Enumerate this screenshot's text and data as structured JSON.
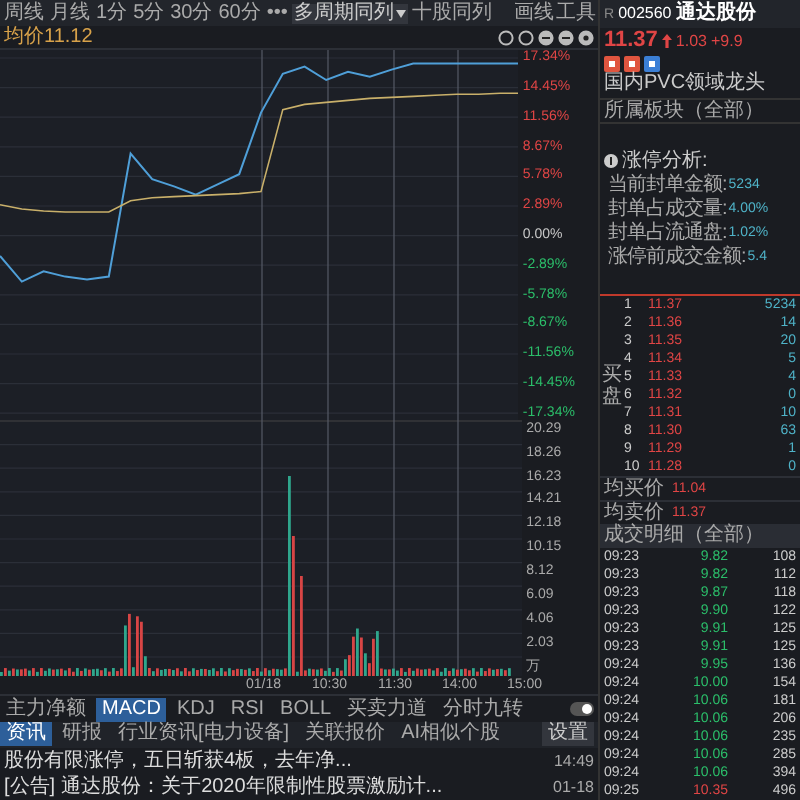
{
  "toolbar": {
    "tabs": [
      {
        "label": "周线",
        "selected": false
      },
      {
        "label": "月线",
        "selected": false
      },
      {
        "label": "1分",
        "selected": false
      },
      {
        "label": "5分",
        "selected": false
      },
      {
        "label": "30分",
        "selected": false
      },
      {
        "label": "60分",
        "selected": false
      },
      {
        "label": "•••",
        "selected": false
      }
    ],
    "multi_period": "多周期同列",
    "ten_stock": "十股同列",
    "tools": [
      "画线",
      "工具"
    ]
  },
  "chart": {
    "avg_price": "均价11.12",
    "chart_data": {
      "type": "line",
      "categories": [
        null,
        null,
        null,
        null,
        null,
        null,
        null,
        null,
        null,
        null,
        null,
        null,
        null,
        null,
        null,
        null,
        null,
        null,
        null,
        null,
        null,
        null,
        null,
        null,
        null
      ],
      "series": [
        {
          "color": "#4f9fd8",
          "values": [
            -2,
            -4.5,
            -3.5,
            -4,
            -4.3,
            -4,
            8,
            5.5,
            4.8,
            4,
            5,
            6,
            12,
            15.8,
            16.5,
            15.2,
            16,
            15.5,
            16.2,
            16.8,
            16.8,
            16.8,
            16.8,
            16.8,
            16.8
          ]
        },
        {
          "color": "#c9b06a",
          "values": [
            3,
            2.6,
            2.4,
            2.3,
            2.3,
            2.3,
            3.4,
            3.7,
            3.8,
            3.9,
            4,
            4.1,
            4.3,
            12.3,
            12.8,
            13,
            13.2,
            13.4,
            13.5,
            13.6,
            13.7,
            13.8,
            13.8,
            13.9,
            13.9
          ]
        }
      ],
      "ylim": [
        -17.34,
        17.34
      ],
      "grid": true,
      "yticks": [
        {
          "value": 17.34,
          "label": "17.34%"
        },
        {
          "value": 14.45,
          "label": "14.45%"
        },
        {
          "value": 11.56,
          "label": "11.56%"
        },
        {
          "value": 8.67,
          "label": "8.67%"
        },
        {
          "value": 5.78,
          "label": "5.78%"
        },
        {
          "value": 2.89,
          "label": "2.89%"
        },
        {
          "value": 0,
          "label": "0.00%"
        },
        {
          "value": -2.89,
          "label": "-2.89%"
        },
        {
          "value": -5.78,
          "label": "-5.78%"
        },
        {
          "value": -8.67,
          "label": "-8.67%"
        },
        {
          "value": -11.56,
          "label": "-11.56%"
        },
        {
          "value": -14.45,
          "label": "-14.45%"
        },
        {
          "value": -17.34,
          "label": "-17.34%"
        }
      ]
    },
    "time_labels": [
      "01/18",
      "10:30",
      "11:30",
      "14:00",
      "15:00"
    ],
    "volume_labels": [
      "20.29",
      "18.26",
      "16.23",
      "14.21",
      "12.18",
      "10.15",
      "8.12",
      "6.09",
      "4.06",
      "2.03",
      "万"
    ]
  },
  "indicator_tabs": [
    {
      "label": "主力净额",
      "selected": false
    },
    {
      "label": "MACD",
      "selected": true
    },
    {
      "label": "KDJ",
      "selected": false
    },
    {
      "label": "RSI",
      "selected": false
    },
    {
      "label": "BOLL",
      "selected": false
    },
    {
      "label": "买卖力道",
      "selected": false
    },
    {
      "label": "分时九转",
      "selected": false
    }
  ],
  "toggle": {
    "on": true
  },
  "news_tabs": [
    {
      "label": "资讯",
      "selected": true
    },
    {
      "label": "研报",
      "selected": false
    },
    {
      "label": "行业资讯[电力设备]",
      "selected": false
    },
    {
      "label": "关联报价",
      "selected": false
    },
    {
      "label": "AI相似个股",
      "selected": false
    }
  ],
  "settings_button": "设置",
  "news": [
    {
      "text": "股份有限涨停，五日斩获4板，去年净...",
      "time": "14:49"
    },
    {
      "tag": "[公告]",
      "text": "通达股份：关于2020年限制性股票激励计...",
      "time": "01-18"
    }
  ],
  "quote": {
    "market": "R",
    "code": "002560",
    "name": "通达股份",
    "price": "11.37",
    "change": "1.03",
    "pct": "+9.9",
    "tagline": "国内PVC领域龙头",
    "sector": "所属板块（全部）"
  },
  "limit_analysis": {
    "title": "涨停分析:",
    "rows": [
      {
        "label": "当前封单金额:",
        "value": "5234"
      },
      {
        "label": "封单占成交量:",
        "value": "4.00%"
      },
      {
        "label": "封单占流通盘:",
        "value": "1.02%"
      },
      {
        "label": "涨停前成交金额:",
        "value": "5.4"
      }
    ]
  },
  "order_book": {
    "side": "买盘",
    "levels": [
      {
        "index": "1",
        "price": "11.37",
        "volume": "5234"
      },
      {
        "index": "2",
        "price": "11.36",
        "volume": "14"
      },
      {
        "index": "3",
        "price": "11.35",
        "volume": "20"
      },
      {
        "index": "4",
        "price": "11.34",
        "volume": "5"
      },
      {
        "index": "5",
        "price": "11.33",
        "volume": "4"
      },
      {
        "index": "6",
        "price": "11.32",
        "volume": "0"
      },
      {
        "index": "7",
        "price": "11.31",
        "volume": "10"
      },
      {
        "index": "8",
        "price": "11.30",
        "volume": "63"
      },
      {
        "index": "9",
        "price": "11.29",
        "volume": "1"
      },
      {
        "index": "10",
        "price": "11.28",
        "volume": "0"
      }
    ]
  },
  "averages": [
    {
      "label": "均买价",
      "value": "11.04"
    },
    {
      "label": "均卖价",
      "value": "11.37"
    }
  ],
  "trades": {
    "title": "成交明细（全部）",
    "rows": [
      {
        "time": "09:23",
        "price": "9.82",
        "volume": "108",
        "color": "#2bbf6a"
      },
      {
        "time": "09:23",
        "price": "9.82",
        "volume": "112",
        "color": "#2bbf6a"
      },
      {
        "time": "09:23",
        "price": "9.87",
        "volume": "118",
        "color": "#2bbf6a"
      },
      {
        "time": "09:23",
        "price": "9.90",
        "volume": "122",
        "color": "#2bbf6a"
      },
      {
        "time": "09:23",
        "price": "9.91",
        "volume": "125",
        "color": "#2bbf6a"
      },
      {
        "time": "09:23",
        "price": "9.91",
        "volume": "125",
        "color": "#2bbf6a"
      },
      {
        "time": "09:24",
        "price": "9.95",
        "volume": "136",
        "color": "#2bbf6a"
      },
      {
        "time": "09:24",
        "price": "10.00",
        "volume": "154",
        "color": "#2bbf6a"
      },
      {
        "time": "09:24",
        "price": "10.06",
        "volume": "181",
        "color": "#2bbf6a"
      },
      {
        "time": "09:24",
        "price": "10.06",
        "volume": "206",
        "color": "#2bbf6a"
      },
      {
        "time": "09:24",
        "price": "10.06",
        "volume": "235",
        "color": "#2bbf6a"
      },
      {
        "time": "09:24",
        "price": "10.06",
        "volume": "285",
        "color": "#2bbf6a"
      },
      {
        "time": "09:24",
        "price": "10.06",
        "volume": "394",
        "color": "#2bbf6a"
      },
      {
        "time": "09:25",
        "price": "10.35",
        "volume": "496",
        "color": "#e04545"
      }
    ]
  }
}
